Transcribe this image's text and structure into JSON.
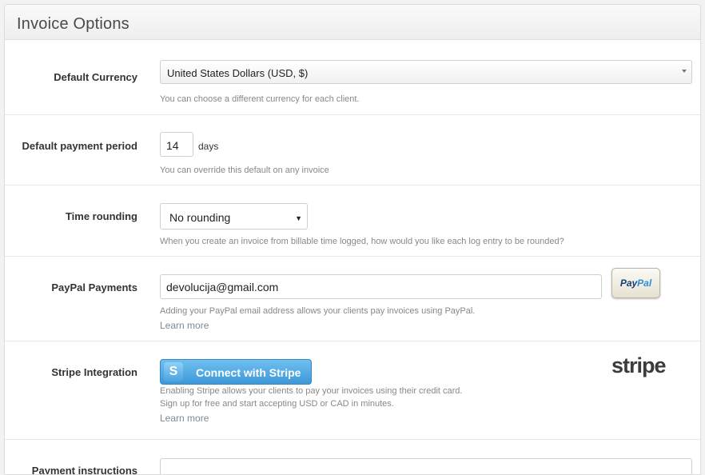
{
  "header": {
    "title": "Invoice Options"
  },
  "currency": {
    "label": "Default Currency",
    "value": "United States Dollars (USD, $)",
    "help": "You can choose a different currency for each client."
  },
  "payment_period": {
    "label": "Default payment period",
    "value": "14",
    "unit": "days",
    "help": "You can override this default on any invoice"
  },
  "time_rounding": {
    "label": "Time rounding",
    "value": "No rounding",
    "help": "When you create an invoice from billable time logged, how would you like each log entry to be rounded?"
  },
  "paypal": {
    "label": "PayPal Payments",
    "value": "devolucija@gmail.com",
    "help": "Adding your PayPal email address allows your clients pay invoices using PayPal.",
    "learn_more": "Learn more",
    "badge_part1": "Pay",
    "badge_part2": "Pal"
  },
  "stripe": {
    "label": "Stripe Integration",
    "button_label": "Connect with Stripe",
    "button_icon": "S",
    "help_line1": "Enabling Stripe allows your clients to pay your invoices using their credit card.",
    "help_line2": "Sign up for free and start accepting USD or CAD in minutes.",
    "learn_more": "Learn more",
    "logo_text": "stripe"
  },
  "instructions": {
    "label": "Payment instructions"
  }
}
